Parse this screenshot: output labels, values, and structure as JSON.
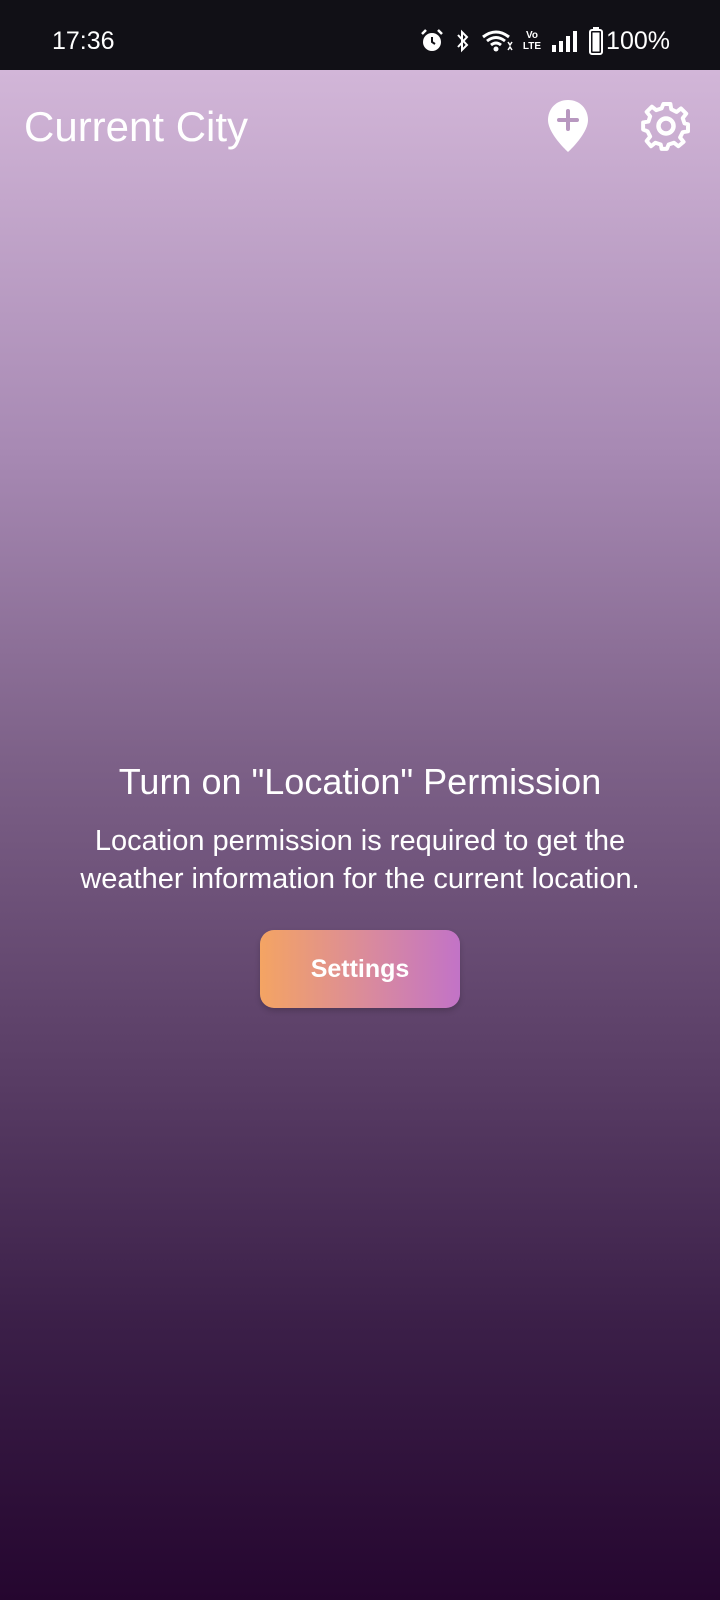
{
  "status_bar": {
    "time": "17:36",
    "icons": [
      "alarm-icon",
      "bluetooth-icon",
      "wifi-icon",
      "volte-icon",
      "signal-icon",
      "battery-icon"
    ],
    "volte_top": "Vo",
    "volte_bottom": "LTE",
    "battery_percent": "100%"
  },
  "header": {
    "title": "Current City",
    "add_location_icon": "location-pin-add-icon",
    "settings_icon": "gear-icon"
  },
  "permission": {
    "title": "Turn on \"Location\" Permission",
    "description_line1": "Location permission is required to get the",
    "description_line2": "weather information for the current location.",
    "button_label": "Settings"
  },
  "colors": {
    "status_bar_bg": "#111016",
    "gradient_top": "#d2b6d8",
    "gradient_bottom": "#25062f",
    "button_start": "#f4a463",
    "button_end": "#c273c7",
    "text": "#ffffff"
  }
}
